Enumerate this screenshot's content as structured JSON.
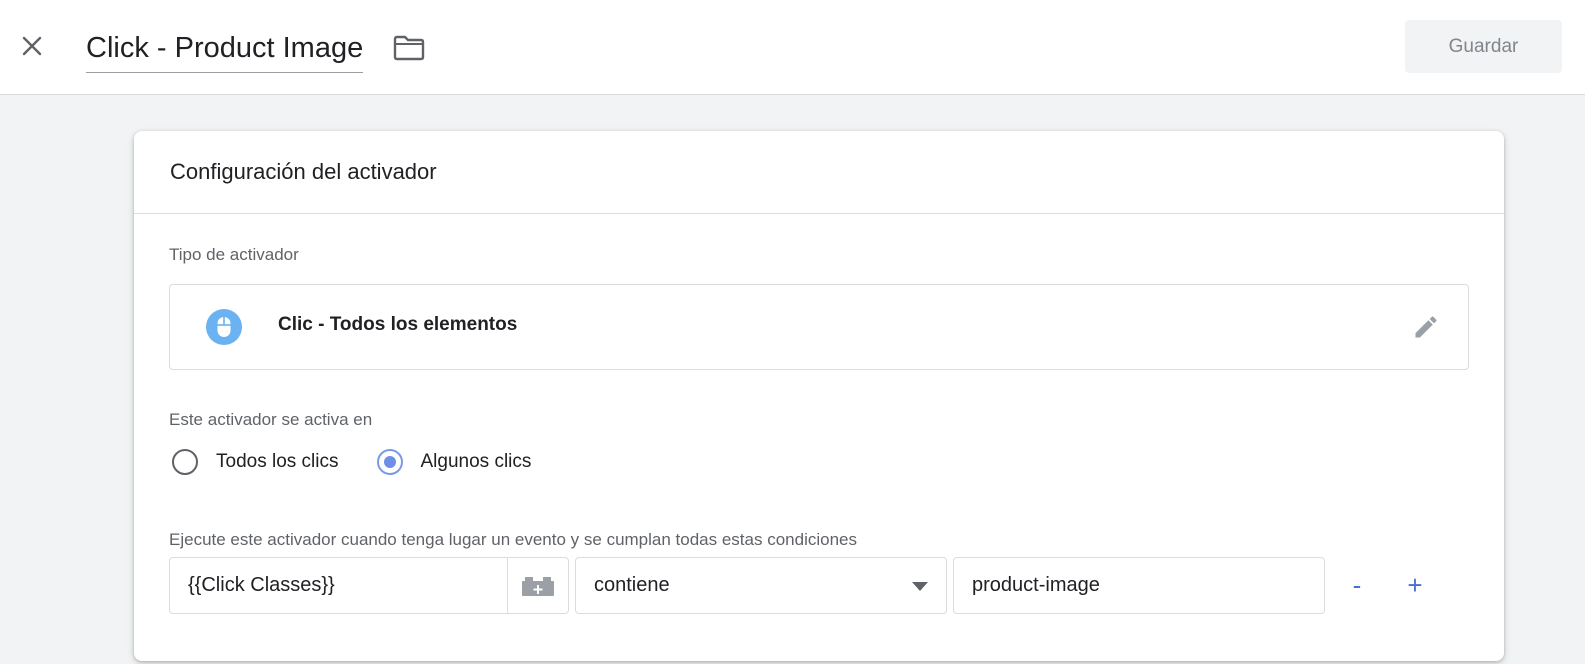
{
  "header": {
    "title": "Click - Product Image",
    "save_label": "Guardar"
  },
  "card": {
    "title": "Configuración del activador",
    "trigger_type_label": "Tipo de activador",
    "trigger_type": {
      "name": "Clic - Todos los elementos",
      "icon": "mouse-icon",
      "icon_color": "#6ab2f2"
    },
    "fires_on_label": "Este activador se activa en",
    "fires_on_options": [
      {
        "label": "Todos los clics",
        "selected": false
      },
      {
        "label": "Algunos clics",
        "selected": true
      }
    ],
    "conditions_label": "Ejecute este activador cuando tenga lugar un evento y se cumplan todas estas condiciones",
    "condition": {
      "variable": "{{Click Classes}}",
      "operator": "contiene",
      "value": "product-image",
      "remove_label": "-",
      "add_label": "+"
    }
  },
  "colors": {
    "accent": "#4a6fd9",
    "radio_selected": "#6d8fe8"
  }
}
